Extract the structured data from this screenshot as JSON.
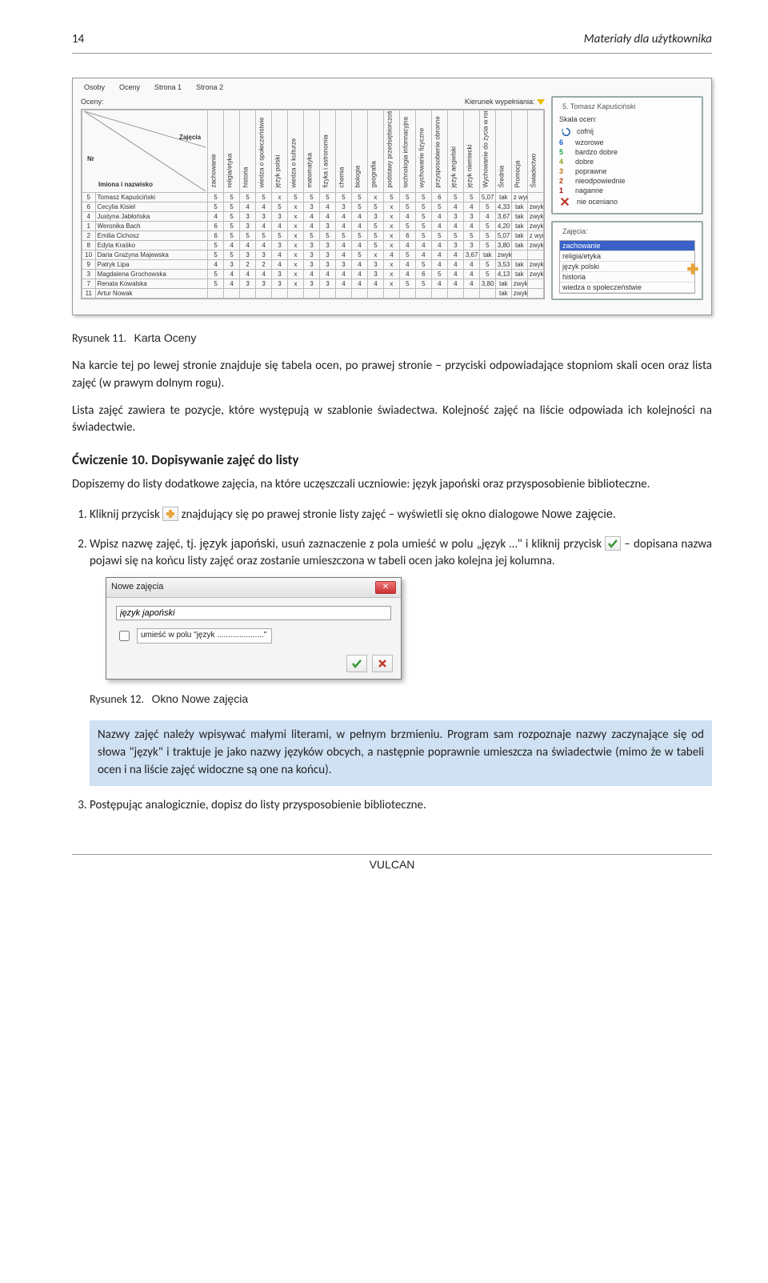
{
  "header": {
    "page_number": "14",
    "section_title": "Materiały dla użytkownika"
  },
  "shot1": {
    "tabs": {
      "osoby": "Osoby",
      "oceny": "Oceny",
      "strona1": "Strona 1",
      "strona2": "Strona 2",
      "p1": "1",
      "p2": "2"
    },
    "labels": {
      "oceny": "Oceny:",
      "kierunek": "Kierunek wypełniania:"
    },
    "corner": {
      "nr": "Nr",
      "zajecia": "Zajęcia",
      "imiona": "Imiona i nazwisko"
    },
    "subjects": [
      "zachowanie",
      "religia/etyka",
      "historia",
      "wiedza o społeczeństwie",
      "język polski",
      "wiedza o kulturze",
      "matematyka",
      "fizyka i astronomia",
      "chemia",
      "biologia",
      "geografia",
      "podstawy przedsiębiorczości",
      "technologia informacyjna",
      "wychowanie fizyczne",
      "przysposobienie obronne",
      "język angielski",
      "język niemiecki",
      "Wychowanie do życia w rodz.",
      "Średnia",
      "Promocja",
      "Świadectwo"
    ],
    "rows": [
      {
        "nr": "5",
        "name": "Tomasz Kapuściński",
        "g": [
          "5",
          "5",
          "5",
          "5",
          "x",
          "5",
          "5",
          "5",
          "5",
          "5",
          "x",
          "5",
          "5",
          "5",
          "6",
          "5",
          "5",
          "5,07",
          "tak",
          "z wyróżnieniem"
        ]
      },
      {
        "nr": "6",
        "name": "Cecylia Kisiel",
        "g": [
          "5",
          "5",
          "4",
          "4",
          "5",
          "x",
          "3",
          "4",
          "3",
          "5",
          "5",
          "x",
          "5",
          "5",
          "5",
          "4",
          "4",
          "5",
          "4,33",
          "tak",
          "zwykłe"
        ]
      },
      {
        "nr": "4",
        "name": "Justyna Jabłońska",
        "g": [
          "4",
          "5",
          "3",
          "3",
          "3",
          "x",
          "4",
          "4",
          "4",
          "4",
          "3",
          "x",
          "4",
          "5",
          "4",
          "3",
          "3",
          "4",
          "3,67",
          "tak",
          "zwykłe"
        ]
      },
      {
        "nr": "1",
        "name": "Weronika Bach",
        "g": [
          "6",
          "5",
          "3",
          "4",
          "4",
          "x",
          "4",
          "3",
          "4",
          "4",
          "5",
          "x",
          "5",
          "5",
          "4",
          "4",
          "4",
          "5",
          "4,20",
          "tak",
          "zwykłe"
        ]
      },
      {
        "nr": "2",
        "name": "Emilia Cichosz",
        "g": [
          "6",
          "5",
          "5",
          "5",
          "5",
          "x",
          "5",
          "5",
          "5",
          "5",
          "5",
          "x",
          "6",
          "5",
          "5",
          "5",
          "5",
          "5",
          "5,07",
          "tak",
          "z wyróżnieniem"
        ]
      },
      {
        "nr": "8",
        "name": "Edyta Kraśko",
        "g": [
          "5",
          "4",
          "4",
          "4",
          "3",
          "x",
          "3",
          "3",
          "4",
          "4",
          "5",
          "x",
          "4",
          "4",
          "4",
          "3",
          "3",
          "5",
          "3,80",
          "tak",
          "zwykłe"
        ]
      },
      {
        "nr": "10",
        "name": "Daria Grażyna Majewska",
        "g": [
          "5",
          "5",
          "3",
          "3",
          "4",
          "x",
          "3",
          "3",
          "4",
          "5",
          "x",
          "4",
          "5",
          "4",
          "4",
          "4",
          "3,67",
          "tak",
          "zwykłe"
        ]
      },
      {
        "nr": "9",
        "name": "Patryk Lipa",
        "g": [
          "4",
          "3",
          "2",
          "2",
          "4",
          "x",
          "3",
          "3",
          "3",
          "4",
          "3",
          "x",
          "4",
          "5",
          "4",
          "4",
          "4",
          "5",
          "3,53",
          "tak",
          "zwykłe"
        ]
      },
      {
        "nr": "3",
        "name": "Magdalena Grochowska",
        "g": [
          "5",
          "4",
          "4",
          "4",
          "3",
          "x",
          "4",
          "4",
          "4",
          "4",
          "3",
          "x",
          "4",
          "6",
          "5",
          "4",
          "4",
          "5",
          "4,13",
          "tak",
          "zwykłe"
        ]
      },
      {
        "nr": "7",
        "name": "Renata Kowalska",
        "g": [
          "5",
          "4",
          "3",
          "3",
          "3",
          "x",
          "3",
          "3",
          "4",
          "4",
          "4",
          "x",
          "5",
          "5",
          "4",
          "4",
          "4",
          "3,80",
          "tak",
          "zwykłe"
        ]
      },
      {
        "nr": "11",
        "name": "Artur Nowak",
        "g": [
          "",
          "",
          "",
          "",
          "",
          "",
          "",
          "",
          "",
          "",
          "",
          "",
          "",
          "",
          "",
          "",
          "",
          "",
          "tak",
          "zwykłe"
        ]
      }
    ],
    "right_panel": {
      "title": "5. Tomasz Kapuściński",
      "skala_title": "Skala ocen:",
      "scale": [
        {
          "icon": "undo",
          "label": "cofnij"
        },
        {
          "num": "6",
          "cls": "c6",
          "label": "wzorowe"
        },
        {
          "num": "5",
          "cls": "c5",
          "label": "bardzo dobre"
        },
        {
          "num": "4",
          "cls": "c4",
          "label": "dobre"
        },
        {
          "num": "3",
          "cls": "c3",
          "label": "poprawne"
        },
        {
          "num": "2",
          "cls": "c2",
          "label": "nieodpowiednie"
        },
        {
          "num": "1",
          "cls": "c1",
          "label": "naganne"
        },
        {
          "icon": "cross",
          "label": "nie oceniano"
        }
      ],
      "zajecia_title": "Zajęcia:",
      "zajecia": [
        "zachowanie",
        "religia/etyka",
        "język polski",
        "historia",
        "wiedza o społeczeństwie"
      ],
      "zajecia_selected": 0
    }
  },
  "caption1": {
    "prefix": "Rysunek 11.",
    "text": "Karta Oceny"
  },
  "para1": "Na karcie tej po lewej stronie znajduje się tabela ocen, po prawej stronie – przyciski odpowiadające stopniom skali ocen oraz lista zajęć (w prawym dolnym rogu).",
  "para2": "Lista zajęć zawiera te pozycje, które występują w szablonie świadectwa. Kolejność zajęć na liście odpowiada ich kolejności na świadectwie.",
  "exercise_heading": "Ćwiczenie 10.  Dopisywanie zajęć do listy",
  "para3": "Dopiszemy do listy dodatkowe zajęcia, na które uczęszczali uczniowie: język japoński oraz przysposobienie biblioteczne.",
  "step1_a": "Kliknij przycisk ",
  "step1_b": " znajdujący się po prawej stronie listy zajęć – wyświetli się okno dialogowe ",
  "step1_c": "Nowe zajęcie",
  "step1_d": ".",
  "step2_a": "Wpisz nazwę zajęć, tj. ",
  "step2_b": "język japoński",
  "step2_c": ", usuń zaznaczenie z pola umieść w polu „język …\" i kliknij przycisk ",
  "step2_d": " – dopisana nazwa pojawi się na końcu listy zajęć oraz zostanie umieszczona w tabeli ocen jako kolejna jej kolumna.",
  "dlg": {
    "title": "Nowe zajęcia",
    "input_value": "język japoński",
    "checkbox_label": "umieść w polu \"język .....................\""
  },
  "caption2": {
    "prefix": "Rysunek 12.",
    "text": "Okno Nowe zajęcia"
  },
  "callout": "Nazwy zajęć należy wpisywać małymi literami, w pełnym brzmieniu. Program sam rozpoznaje nazwy zaczynające się od słowa \"język\" i traktuje je jako nazwy języków obcych, a następnie poprawnie umieszcza na świadectwie (mimo że w tabeli ocen i na liście zajęć widoczne są one na końcu).",
  "step3": "Postępując analogicznie, dopisz do listy przysposobienie biblioteczne.",
  "footer": {
    "brand": "VULCAN"
  },
  "chart_data": {
    "type": "table",
    "title": "Oceny",
    "columns": [
      "Nr",
      "Imiona i nazwisko",
      "zachowanie",
      "religia/etyka",
      "historia",
      "wiedza o społeczeństwie",
      "język polski",
      "wiedza o kulturze",
      "matematyka",
      "fizyka i astronomia",
      "chemia",
      "biologia",
      "geografia",
      "podstawy przedsiębiorczości",
      "technologia informacyjna",
      "wychowanie fizyczne",
      "przysposobienie obronne",
      "język angielski",
      "język niemiecki",
      "Wychowanie do życia w rodz.",
      "Średnia",
      "Promocja",
      "Świadectwo"
    ],
    "rows": [
      [
        "5",
        "Tomasz Kapuściński",
        "5",
        "5",
        "5",
        "5",
        "x",
        "5",
        "5",
        "5",
        "5",
        "5",
        "x",
        "5",
        "5",
        "5",
        "6",
        "5",
        "5",
        "5,07",
        "tak",
        "z wyróżnieniem"
      ],
      [
        "6",
        "Cecylia Kisiel",
        "5",
        "5",
        "4",
        "4",
        "5",
        "x",
        "3",
        "4",
        "3",
        "5",
        "5",
        "x",
        "5",
        "5",
        "5",
        "4",
        "4",
        "5",
        "4,33",
        "tak",
        "zwykłe"
      ],
      [
        "4",
        "Justyna Jabłońska",
        "4",
        "5",
        "3",
        "3",
        "3",
        "x",
        "4",
        "4",
        "4",
        "4",
        "3",
        "x",
        "4",
        "5",
        "4",
        "3",
        "3",
        "4",
        "3,67",
        "tak",
        "zwykłe"
      ],
      [
        "1",
        "Weronika Bach",
        "6",
        "5",
        "3",
        "4",
        "4",
        "x",
        "4",
        "3",
        "4",
        "4",
        "5",
        "x",
        "5",
        "5",
        "4",
        "4",
        "4",
        "5",
        "4,20",
        "tak",
        "zwykłe"
      ],
      [
        "2",
        "Emilia Cichosz",
        "6",
        "5",
        "5",
        "5",
        "5",
        "x",
        "5",
        "5",
        "5",
        "5",
        "5",
        "x",
        "6",
        "5",
        "5",
        "5",
        "5",
        "5",
        "5,07",
        "tak",
        "z wyróżnieniem"
      ],
      [
        "8",
        "Edyta Kraśko",
        "5",
        "4",
        "4",
        "4",
        "3",
        "x",
        "3",
        "3",
        "4",
        "4",
        "5",
        "x",
        "4",
        "4",
        "4",
        "3",
        "3",
        "5",
        "3,80",
        "tak",
        "zwykłe"
      ],
      [
        "10",
        "Daria Grażyna Majewska",
        "5",
        "5",
        "3",
        "3",
        "4",
        "x",
        "3",
        "3",
        "4",
        "5",
        "x",
        "4",
        "5",
        "4",
        "4",
        "4",
        "3,67",
        "tak",
        "zwykłe"
      ],
      [
        "9",
        "Patryk Lipa",
        "4",
        "3",
        "2",
        "2",
        "4",
        "x",
        "3",
        "3",
        "3",
        "4",
        "3",
        "x",
        "4",
        "5",
        "4",
        "4",
        "4",
        "5",
        "3,53",
        "tak",
        "zwykłe"
      ],
      [
        "3",
        "Magdalena Grochowska",
        "5",
        "4",
        "4",
        "4",
        "3",
        "x",
        "4",
        "4",
        "4",
        "4",
        "3",
        "x",
        "4",
        "6",
        "5",
        "4",
        "4",
        "5",
        "4,13",
        "tak",
        "zwykłe"
      ],
      [
        "7",
        "Renata Kowalska",
        "5",
        "4",
        "3",
        "3",
        "3",
        "x",
        "3",
        "3",
        "4",
        "4",
        "4",
        "x",
        "5",
        "5",
        "4",
        "4",
        "4",
        "3,80",
        "tak",
        "zwykłe"
      ],
      [
        "11",
        "Artur Nowak",
        "",
        "",
        "",
        "",
        "",
        "",
        "",
        "",
        "",
        "",
        "",
        "",
        "",
        "",
        "",
        "",
        "",
        "",
        "tak",
        "zwykłe"
      ]
    ]
  }
}
